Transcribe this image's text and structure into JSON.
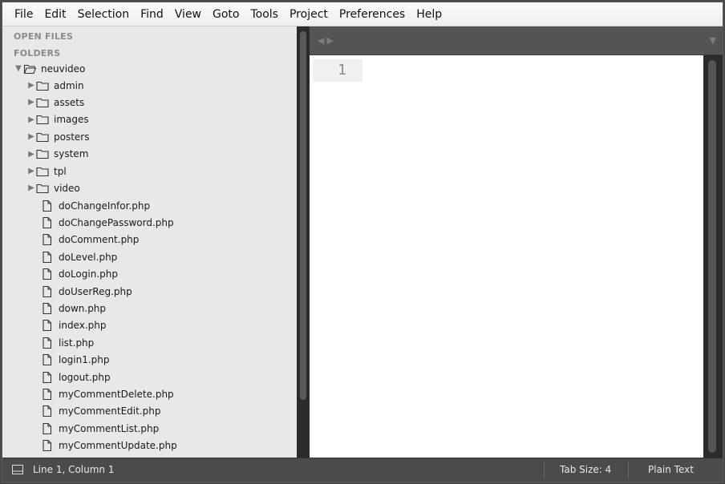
{
  "menu": {
    "items": [
      "File",
      "Edit",
      "Selection",
      "Find",
      "View",
      "Goto",
      "Tools",
      "Project",
      "Preferences",
      "Help"
    ]
  },
  "sidebar": {
    "open_files_label": "OPEN FILES",
    "folders_label": "FOLDERS",
    "root_folder": "neuvideo",
    "folders": [
      "admin",
      "assets",
      "images",
      "posters",
      "system",
      "tpl",
      "video"
    ],
    "files": [
      "doChangeInfor.php",
      "doChangePassword.php",
      "doComment.php",
      "doLevel.php",
      "doLogin.php",
      "doUserReg.php",
      "down.php",
      "index.php",
      "list.php",
      "login1.php",
      "logout.php",
      "myCommentDelete.php",
      "myCommentEdit.php",
      "myCommentList.php",
      "myCommentUpdate.php"
    ]
  },
  "editor": {
    "line_number": "1"
  },
  "statusbar": {
    "position": "Line 1, Column 1",
    "tab_size": "Tab Size: 4",
    "syntax": "Plain Text"
  }
}
